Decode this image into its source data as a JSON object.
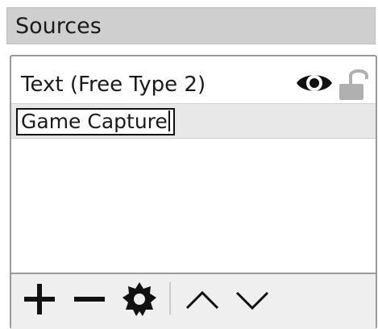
{
  "header": {
    "title": "Sources"
  },
  "sources": {
    "items": [
      {
        "label": "Text (Free Type 2)",
        "visible_icon": "eye-icon",
        "lock_icon": "unlocked-padlock-icon"
      },
      {
        "rename_value": "Game Capture",
        "state": "renaming"
      }
    ]
  },
  "toolbar": {
    "buttons": [
      {
        "icon": "plus-icon"
      },
      {
        "icon": "minus-icon"
      },
      {
        "icon": "gear-icon"
      },
      {
        "icon": "chevron-up-icon"
      },
      {
        "icon": "chevron-down-icon"
      }
    ]
  }
}
